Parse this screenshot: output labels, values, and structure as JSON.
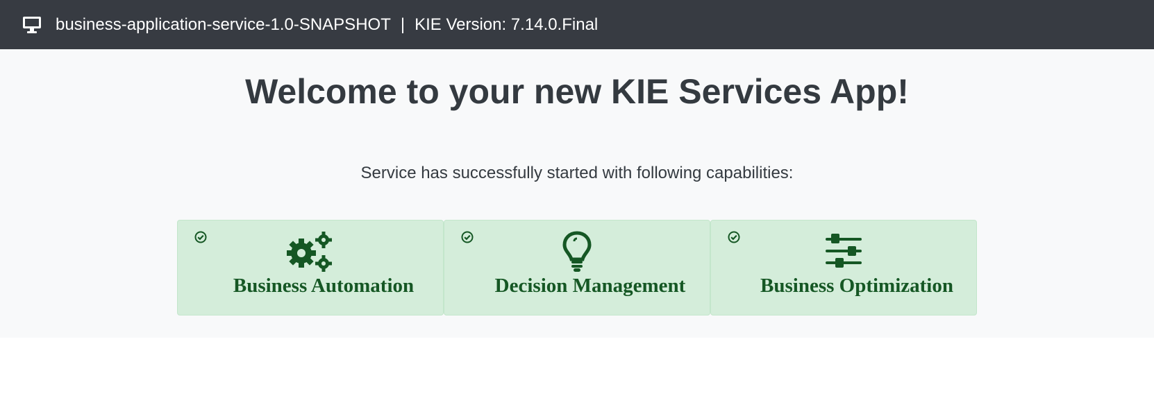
{
  "header": {
    "app_name": "business-application-service-1.0-SNAPSHOT",
    "separator": "|",
    "version_text": "KIE Version: 7.14.0.Final",
    "icon": "desktop-monitor-icon"
  },
  "main": {
    "headline": "Welcome to your new KIE Services App!",
    "subtitle": "Service has successfully started with following capabilities:"
  },
  "capabilities": [
    {
      "label": "Business Automation",
      "icon": "cogs-icon",
      "status_icon": "check-circle-icon"
    },
    {
      "label": "Decision Management",
      "icon": "lightbulb-icon",
      "status_icon": "check-circle-icon"
    },
    {
      "label": "Business Optimization",
      "icon": "sliders-icon",
      "status_icon": "check-circle-icon"
    }
  ],
  "colors": {
    "topbar_bg": "#373b42",
    "card_bg": "#d4edda",
    "card_text": "#155724",
    "page_bg": "#f8f9fa"
  }
}
